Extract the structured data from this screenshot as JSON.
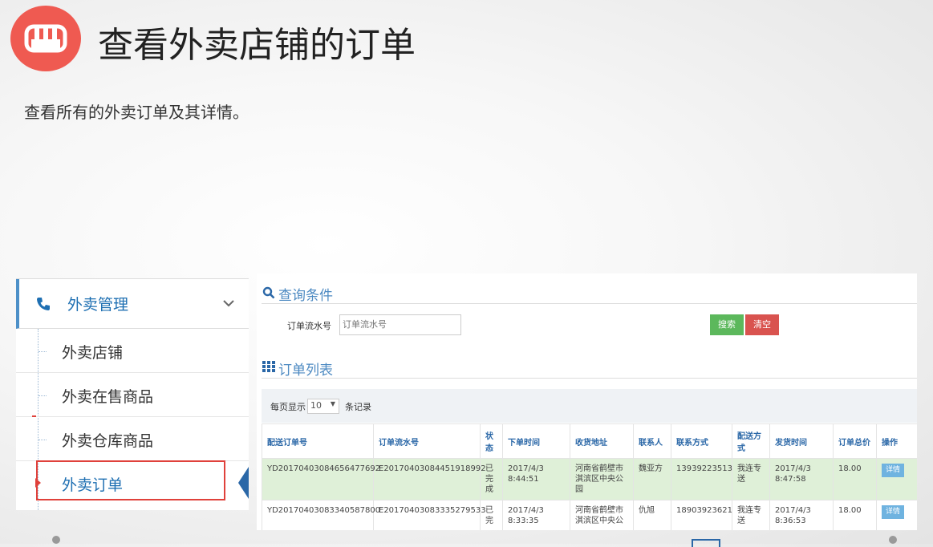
{
  "page": {
    "title": "查看外卖店铺的订单",
    "subtitle": "查看所有的外卖订单及其详情。"
  },
  "sidebar": {
    "header": "外卖管理",
    "items": [
      {
        "label": "外卖店铺"
      },
      {
        "label": "外卖在售商品"
      },
      {
        "label": "外卖仓库商品"
      },
      {
        "label": "外卖订单"
      }
    ]
  },
  "query": {
    "title": "查询条件",
    "field_label": "订单流水号",
    "placeholder": "订单流水号",
    "search_btn": "搜索",
    "clear_btn": "清空"
  },
  "list": {
    "title": "订单列表",
    "per_page_prefix": "每页显示",
    "per_page_value": "10",
    "per_page_suffix": "条记录",
    "headers": [
      "配送订单号",
      "订单流水号",
      "状态",
      "下单时间",
      "收货地址",
      "联系人",
      "联系方式",
      "配送方式",
      "发货时间",
      "订单总价",
      "操作"
    ],
    "rows": [
      {
        "delivery_no": "YD20170403084656477692",
        "serial": "E20170403084451918992",
        "status": "已完成",
        "order_time": "2017/4/3 8:44:51",
        "address": "河南省鹤壁市淇滨区中央公园",
        "contact": "魏亚方",
        "phone": "13939223513",
        "method": "我连专送",
        "ship_time": "2017/4/3 8:47:58",
        "total": "18.00",
        "action": "详情"
      },
      {
        "delivery_no": "YD20170403083340587800",
        "serial": "E20170403083335279533",
        "status": "已完",
        "order_time": "2017/4/3 8:33:35",
        "address": "河南省鹤壁市淇滨区中央公",
        "contact": "仇旭",
        "phone": "18903923621",
        "method": "我连专送",
        "ship_time": "2017/4/3 8:36:53",
        "total": "18.00",
        "action": "详情"
      }
    ]
  },
  "colors": {
    "accent": "#4d8ac2",
    "search": "#5cb85c",
    "clear": "#d9534f",
    "logo": "#ef5a51",
    "selected_row": "#dff0d8"
  }
}
